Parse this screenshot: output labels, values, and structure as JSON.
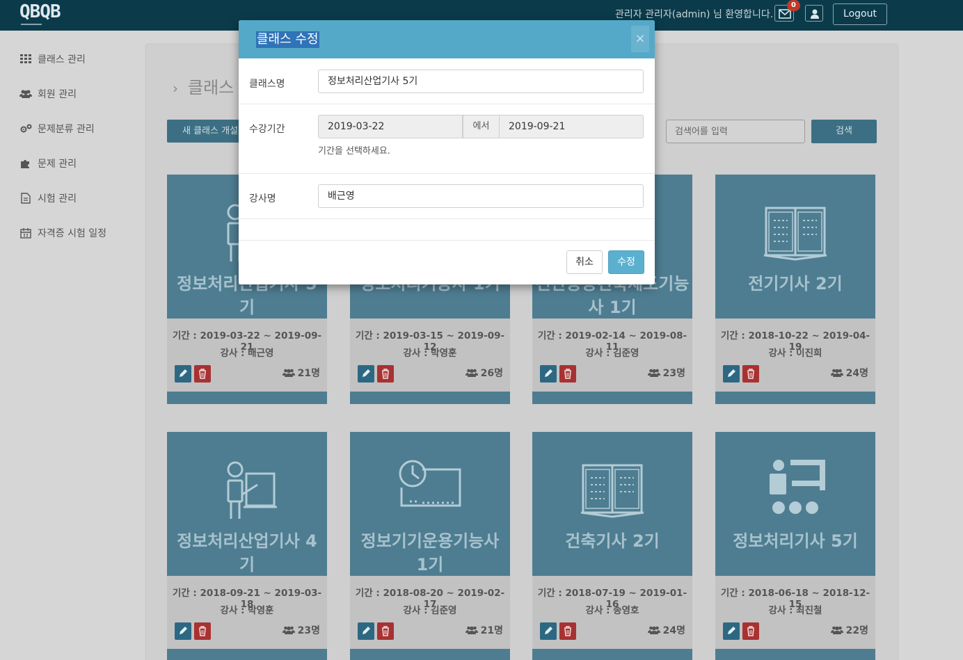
{
  "header": {
    "logo": "QBQB",
    "welcome": "관리자 관리자(admin) 님 환영합니다.",
    "mail_count": "0",
    "logout_label": "Logout"
  },
  "sidebar": {
    "items": [
      {
        "label": "클래스 관리",
        "icon": "grid-icon"
      },
      {
        "label": "회원 관리",
        "icon": "users-icon"
      },
      {
        "label": "문제분류 관리",
        "icon": "gears-icon"
      },
      {
        "label": "문제 관리",
        "icon": "puzzle-icon"
      },
      {
        "label": "시험 관리",
        "icon": "file-icon"
      },
      {
        "label": "자격증 시험 일정",
        "icon": "calendar-icon"
      }
    ]
  },
  "main": {
    "title": "클래스",
    "new_class_label": "새 클래스 개설",
    "search_placeholder": "검색어를 입력",
    "search_label": "검색"
  },
  "cards": [
    {
      "name": "정보처리산업기사 5기",
      "period": "기간 : 2019-03-22 ~ 2019-09-21",
      "teacher": "강사 : 배근영",
      "count": "21명",
      "icon": "teacher-board-icon"
    },
    {
      "name": "정보처리기능사 1기",
      "period": "기간 : 2019-03-15 ~ 2019-09-12",
      "teacher": "강사 : 박영훈",
      "count": "26명",
      "icon": "clock-board-icon"
    },
    {
      "name": "전산응용건축제도기능사 1기",
      "period": "기간 : 2019-02-14 ~ 2019-08-11",
      "teacher": "강사 : 김준영",
      "count": "23명",
      "icon": "book-icon"
    },
    {
      "name": "전기기사 2기",
      "period": "기간 : 2018-10-22 ~ 2019-04-19",
      "teacher": "강사 : 이진희",
      "count": "24명",
      "icon": "book-icon"
    },
    {
      "name": "정보처리산업기사 4기",
      "period": "기간 : 2018-09-21 ~ 2019-03-18",
      "teacher": "강사 : 박영훈",
      "count": "23명",
      "icon": "teacher-board-icon"
    },
    {
      "name": "정보기기운용기능사 1기",
      "period": "기간 : 2018-08-20 ~ 2019-02-17",
      "teacher": "강사 : 김준영",
      "count": "21명",
      "icon": "clock-board-icon"
    },
    {
      "name": "건축기사 2기",
      "period": "기간 : 2018-07-19 ~ 2019-01-16",
      "teacher": "강사 : 송영호",
      "count": "24명",
      "icon": "book-icon"
    },
    {
      "name": "정보처리기사 5기",
      "period": "기간 : 2018-06-18 ~ 2018-12-15",
      "teacher": "강사 : 최진철",
      "count": "22명",
      "icon": "meeting-icon"
    }
  ],
  "modal": {
    "title": "클래스 수정",
    "close_label": "×",
    "class_name_label": "클래스명",
    "class_name_value": "정보처리산업기사 5기",
    "period_label": "수강기간",
    "start_date": "2019-03-22",
    "range_sep": "에서",
    "end_date": "2019-09-21",
    "period_help": "기간을 선택하세요.",
    "teacher_label": "강사명",
    "teacher_value": "배근영",
    "cancel_label": "취소",
    "submit_label": "수정"
  },
  "colors": {
    "header_bg": "#0b3b4b",
    "card_thumb": "#4e7d91",
    "modal_head": "#55a9c8",
    "primary_btn": "#3c6f84",
    "danger_btn": "#a83232"
  }
}
